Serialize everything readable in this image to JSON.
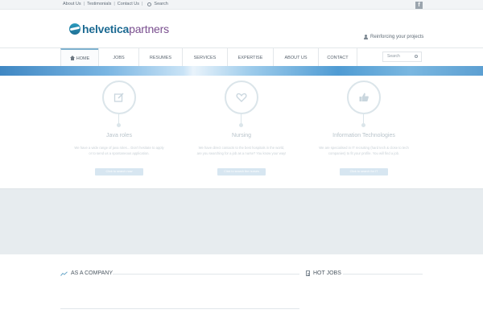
{
  "topbar": {
    "links": [
      "About Us",
      "Testimonials",
      "Contact Us"
    ],
    "search_label": "Search",
    "social": "f"
  },
  "header": {
    "logo_bold": "helvetica",
    "logo_light": "partners",
    "tagline": "Reinforcing your projects"
  },
  "nav": {
    "items": [
      "Home",
      "Jobs",
      "Resumes",
      "Services",
      "Expertise",
      "About Us",
      "Contact"
    ],
    "active": "Home",
    "search_placeholder": "Search"
  },
  "services": [
    {
      "icon": "edit-icon",
      "title": "Java roles",
      "text_line1": "We have a wide range of java roles... Don't hesitate to apply",
      "text_line2": "or to send us a spontaneous application.",
      "button": "Click to search now"
    },
    {
      "icon": "heart-icon",
      "title": "Nursing",
      "text_line1": "We have direct contacts to the best hospitals in the world,",
      "text_line2": "are you searching for a job as a nurse? You know your way!",
      "button": "Click to search the nurses"
    },
    {
      "icon": "thumbs-up-icon",
      "title": "Information Technologies",
      "text_line1": "We are specialised in IT recruiting (hard tech & close to tech",
      "text_line2": "companies) to fit your profile. You will find a job.",
      "button": "Click to search for IT"
    }
  ],
  "sections": {
    "company_title": "As a company",
    "jobs_title": "Hot jobs"
  },
  "colors": {
    "brand_blue": "#1c6a92",
    "brand_purple": "#7a4f8f",
    "accent_light": "#7fb2cf",
    "band_gray": "#e7ecef"
  }
}
